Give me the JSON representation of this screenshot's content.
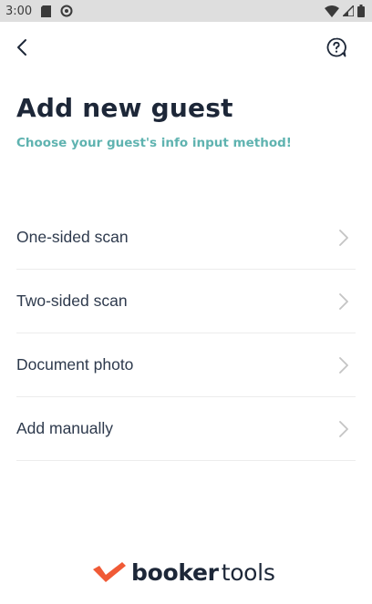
{
  "status_bar": {
    "time": "3:00"
  },
  "header": {
    "back_icon": "chevron-left-icon",
    "help_icon": "question-bubble-icon"
  },
  "title": "Add new guest",
  "subtitle": "Choose your guest's info input method!",
  "options": [
    {
      "label": "One-sided scan"
    },
    {
      "label": "Two-sided scan"
    },
    {
      "label": "Document photo"
    },
    {
      "label": "Add manually"
    }
  ],
  "logo": {
    "bold": "booker",
    "light": "tools"
  },
  "colors": {
    "title": "#1d2738",
    "accent_teal": "#5fb3b0",
    "logo_mark": "#f05a36",
    "status_bar": "#dedede"
  }
}
